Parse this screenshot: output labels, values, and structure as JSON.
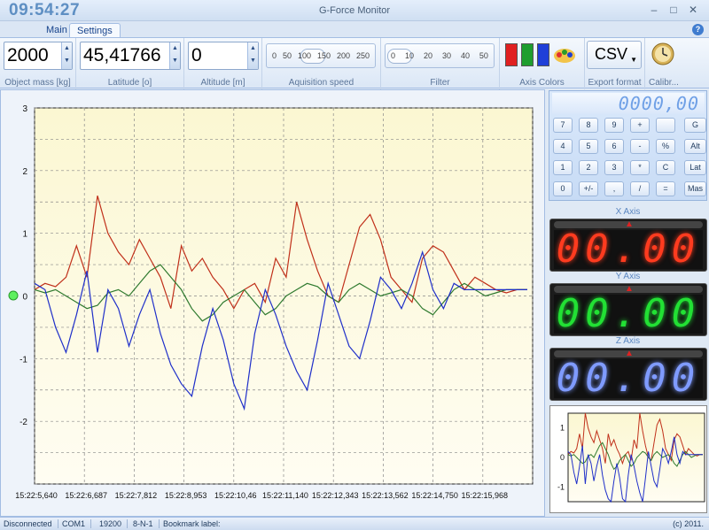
{
  "window": {
    "clock": "09:54:27",
    "title": "G-Force Monitor"
  },
  "tabs": [
    {
      "label": "Main"
    },
    {
      "label": "Settings"
    }
  ],
  "ribbon": {
    "object_mass": {
      "value": "2000",
      "label": "Object mass [kg]"
    },
    "latitude": {
      "value": "45,41766",
      "label": "Latitude [o]"
    },
    "altitude": {
      "value": "0",
      "label": "Altitude [m]"
    },
    "acquisition": {
      "ticks": [
        "0",
        "50",
        "100",
        "150",
        "200",
        "250"
      ],
      "label": "Aquisition speed",
      "value": 100
    },
    "filter": {
      "ticks": [
        "0",
        "10",
        "20",
        "30",
        "40",
        "50"
      ],
      "label": "Filter",
      "value": 0
    },
    "axis_colors": {
      "label": "Axis Colors",
      "colors": [
        "#e02020",
        "#1e9e2e",
        "#1f3fd8"
      ]
    },
    "export": {
      "value": "CSV",
      "label": "Export format"
    },
    "calibrate": {
      "label": "Calibr..."
    }
  },
  "calculator": {
    "display": "0000,00",
    "buttons": [
      [
        "7",
        "8",
        "9",
        "+",
        "",
        "G"
      ],
      [
        "4",
        "5",
        "6",
        "-",
        "%",
        "Alt"
      ],
      [
        "1",
        "2",
        "3",
        "*",
        "C",
        "Lat"
      ],
      [
        "0",
        "+/-",
        ",",
        "/",
        "=",
        "Mas"
      ]
    ]
  },
  "axes_display": {
    "x": {
      "label": "X Axis",
      "value": "00.00",
      "color": "#ff3b1f"
    },
    "y": {
      "label": "Y Axis",
      "value": "00.00",
      "color": "#22e034"
    },
    "z": {
      "label": "Z Axis",
      "value": "00.00",
      "color": "#7f9bff"
    }
  },
  "status": {
    "connection": "Disconnected",
    "port": "COM1",
    "baud": "19200",
    "format": "8-N-1",
    "bookmark": "Bookmark label:",
    "copyright": "(c) 2011."
  },
  "chart_data": {
    "type": "line",
    "ylim": [
      -3,
      3
    ],
    "yticks": [
      "3",
      "2",
      "1",
      "0",
      "-1",
      "-2"
    ],
    "xticks": [
      "15:22:5,640",
      "15:22:6,687",
      "15:22:7,812",
      "15:22:8,953",
      "15:22:10,46",
      "15:22:11,140",
      "15:22:12,343",
      "15:22:13,562",
      "15:22:14,750",
      "15:22:15,968"
    ],
    "series": [
      {
        "color": "#c0301a",
        "values": [
          0.1,
          0.2,
          0.15,
          0.3,
          0.8,
          0.3,
          1.6,
          1.0,
          0.7,
          0.5,
          0.9,
          0.6,
          0.3,
          -0.2,
          0.8,
          0.4,
          0.6,
          0.3,
          0.1,
          -0.2,
          0.1,
          0.2,
          -0.1,
          0.6,
          0.3,
          1.5,
          0.9,
          0.4,
          0.0,
          -0.1,
          0.5,
          1.1,
          1.3,
          0.9,
          0.3,
          0.1,
          -0.1,
          0.6,
          0.8,
          0.7,
          0.4,
          0.1,
          0.3,
          0.2,
          0.1,
          0.05,
          0.1,
          0.1
        ]
      },
      {
        "color": "#2f7a2f",
        "values": [
          0.1,
          0.05,
          0.1,
          0.0,
          -0.1,
          -0.2,
          -0.15,
          0.05,
          0.1,
          0.0,
          0.2,
          0.4,
          0.5,
          0.3,
          0.1,
          -0.2,
          -0.4,
          -0.3,
          -0.1,
          0.0,
          0.1,
          -0.1,
          -0.3,
          -0.2,
          0.0,
          0.1,
          0.2,
          0.15,
          0.0,
          -0.1,
          0.1,
          0.2,
          0.1,
          0.0,
          0.05,
          0.1,
          0.0,
          -0.2,
          -0.3,
          -0.1,
          0.1,
          0.2,
          0.1,
          0.0,
          0.05,
          0.1,
          0.1,
          0.1
        ]
      },
      {
        "color": "#1f2fc9",
        "values": [
          0.2,
          0.1,
          -0.5,
          -0.9,
          -0.3,
          0.4,
          -0.9,
          0.1,
          -0.2,
          -0.8,
          -0.3,
          0.1,
          -0.6,
          -1.1,
          -1.4,
          -1.6,
          -0.8,
          -0.2,
          -0.7,
          -1.4,
          -1.8,
          -0.6,
          0.1,
          -0.3,
          -0.8,
          -1.2,
          -1.5,
          -0.7,
          0.2,
          -0.3,
          -0.8,
          -1.0,
          -0.4,
          0.3,
          0.1,
          -0.2,
          0.2,
          0.7,
          0.1,
          -0.2,
          0.2,
          0.1,
          0.1,
          0.1,
          0.1,
          0.1,
          0.1,
          0.1
        ]
      }
    ]
  }
}
